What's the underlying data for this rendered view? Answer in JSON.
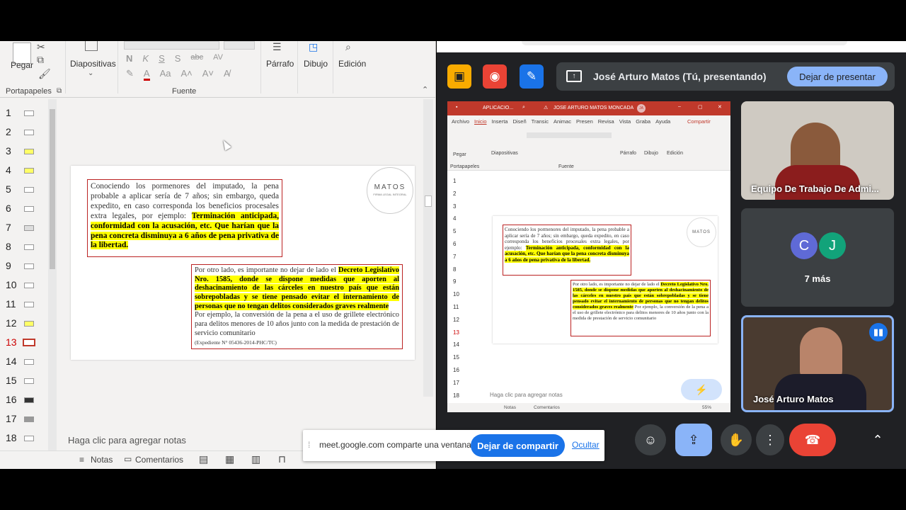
{
  "ppt": {
    "clipboard_label": "Pegar",
    "clipboard_group": "Portapapeles",
    "slides_label": "Diapositivas",
    "font_group": "Fuente",
    "paragraph_label": "Párrafo",
    "drawing_label": "Dibujo",
    "editing_label": "Edición",
    "font_tools": [
      "N",
      "K",
      "S",
      "S",
      "abc",
      "AV"
    ],
    "slide_numbers": [
      "1",
      "2",
      "3",
      "4",
      "5",
      "6",
      "7",
      "8",
      "9",
      "10",
      "11",
      "12",
      "13",
      "14",
      "15",
      "16",
      "17",
      "18"
    ],
    "active_slide": "13",
    "notes_placeholder": "Haga clic para agregar notas",
    "status_notes": "Notas",
    "status_comments": "Comentarios",
    "logo_text": "MATOS",
    "logo_sub": "FIRMA LEGAL INTEGRAL",
    "box1_plain": "Conociendo los pormenores del imputado, la pena probable a aplicar sería de 7 años; sin embargo, queda expedito, en caso corresponda los beneficios procesales extra legales, por ejemplo: ",
    "box1_highlight": "Terminación anticipada, conformidad con la acusación, etc. Que harían que la pena concreta disminuya a 6 años de pena privativa de la libertad.",
    "box2_plain": "Por otro lado, es importante no dejar de lado el ",
    "box2_highlight": "Decreto Legislativo Nro. 1585, donde se dispone medidas que aporten al deshacinamiento de las cárceles en nuestro país que están sobrepobladas y se tiene pensado evitar el internamiento de personas que no tengan delitos considerados graves realmente",
    "box2_rest": "Por ejemplo, la conversión de la pena a el uso de grillete electrónico para delitos menores de 10 años junto con la medida de prestación de servicio comunitario",
    "box2_ref": "(Expediente N° 05436-2014-PHC/TC)"
  },
  "meet": {
    "presenter_text": "José Arturo Matos (Tú, presentando)",
    "stop_presenting": "Dejar de presentar",
    "more_count": "7 más",
    "tile1_name": "Equipo De Trabajo De Admi...",
    "tile3_name": "José Arturo Matos",
    "avatar_c": "C",
    "avatar_j": "J",
    "inner_title": "APLICACIO...",
    "inner_user": "JOSE ARTURO MATOS MONCADA",
    "inner_user_initials": "JA",
    "inner_share": "Compartir",
    "inner_tabs": [
      "Archivo",
      "Inicio",
      "Inserta",
      "Diseñ",
      "Transic",
      "Animac",
      "Presen",
      "Revisa",
      "Vista",
      "Graba",
      "Ayuda"
    ],
    "inner_groups": [
      "Pegar",
      "Diapositivas",
      "Párrafo",
      "Dibujo",
      "Edición"
    ],
    "inner_group_labels": [
      "Portapapeles",
      "Fuente"
    ],
    "inner_notes": "Haga clic para agregar notas",
    "inner_status_notes": "Notas",
    "inner_status_comments": "Comentarios",
    "inner_zoom": "55%"
  },
  "banner": {
    "text": "meet.google.com comparte una ventana.",
    "stop_share": "Dejar de compartir",
    "hide": "Ocultar"
  },
  "colors": {
    "accent_blue": "#1a73e8",
    "red": "#ea4335",
    "yellow": "#f9ab00",
    "highlight": "#ffff00"
  }
}
